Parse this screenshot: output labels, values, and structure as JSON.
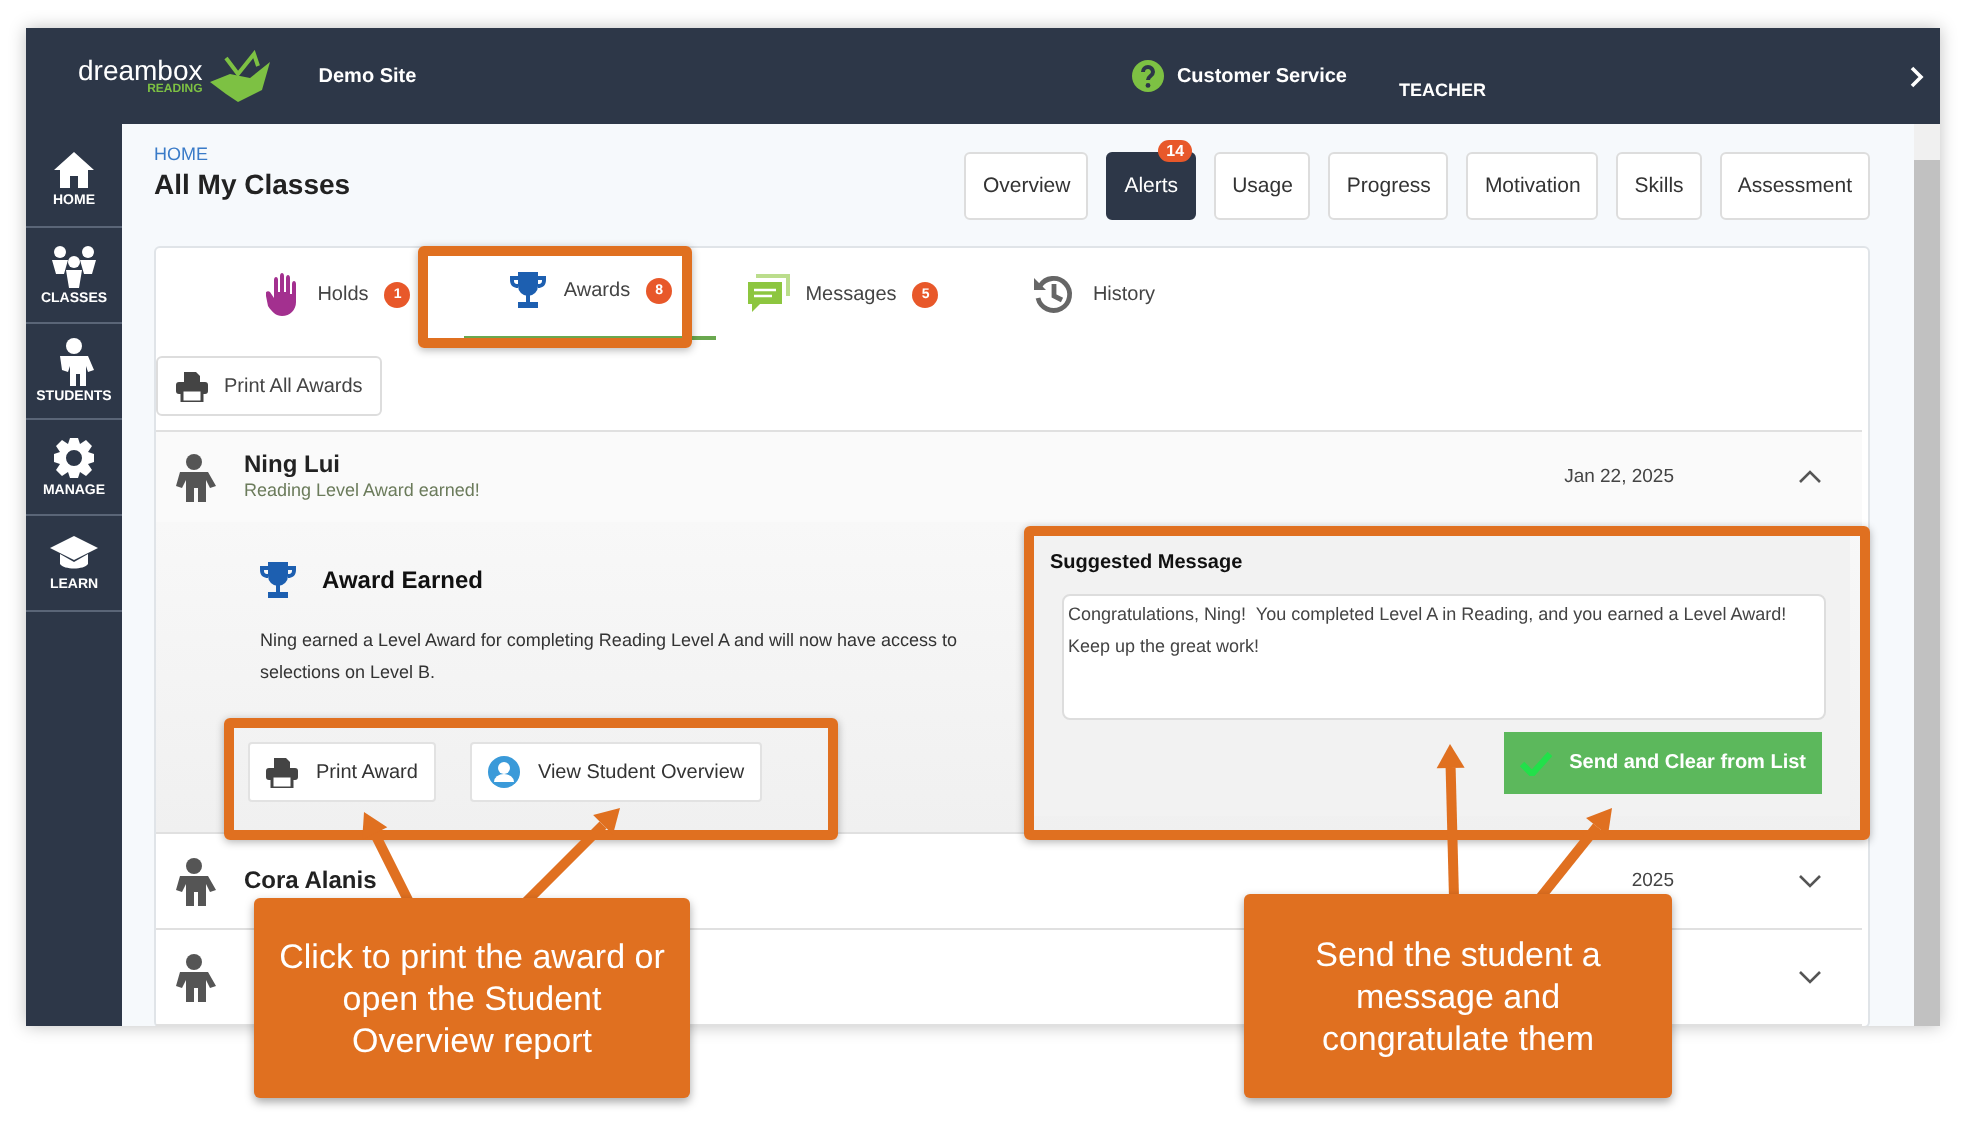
{
  "header": {
    "logo_word": "dreambox",
    "logo_sub": "READING",
    "site": "Demo Site",
    "help": "Customer Service",
    "role": "TEACHER"
  },
  "sidebar": {
    "items": [
      {
        "label": "HOME",
        "kind": "home"
      },
      {
        "label": "CLASSES",
        "kind": "classes"
      },
      {
        "label": "STUDENTS",
        "kind": "students"
      },
      {
        "label": "MANAGE",
        "kind": "manage"
      },
      {
        "label": "LEARN",
        "kind": "learn"
      }
    ]
  },
  "breadcrumb": "HOME",
  "title": "All My Classes",
  "views": [
    {
      "label": "Overview",
      "selected": false
    },
    {
      "label": "Alerts",
      "selected": true,
      "badge": "14"
    },
    {
      "label": "Usage",
      "selected": false
    },
    {
      "label": "Progress",
      "selected": false
    },
    {
      "label": "Motivation",
      "selected": false
    },
    {
      "label": "Skills",
      "selected": false
    },
    {
      "label": "Assessment",
      "selected": false
    }
  ],
  "alert_tabs": [
    {
      "label": "Holds",
      "kind": "hand",
      "badge": "1",
      "selected": false
    },
    {
      "label": "Awards",
      "kind": "trophy",
      "badge": "8",
      "selected": true
    },
    {
      "label": "Messages",
      "kind": "chat",
      "badge": "5",
      "selected": false
    },
    {
      "label": "History",
      "kind": "history",
      "selected": false
    }
  ],
  "print_all": "Print All Awards",
  "students": [
    {
      "name": "Ning Lui",
      "subtitle": "Reading Level Award earned!",
      "date": "Jan 22, 2025",
      "expanded": true
    },
    {
      "name": "Cora Alanis",
      "date": "2025",
      "expanded": false
    },
    {
      "expanded": false
    }
  ],
  "detail": {
    "heading": "Award Earned",
    "body": "Ning earned a Level Award for completing Reading Level A and will now have access to selections on Level B.",
    "buttons": [
      {
        "label": "Print Award",
        "kind": "print"
      },
      {
        "label": "View Student Overview",
        "kind": "student"
      }
    ],
    "suggested_heading": "Suggested Message",
    "message": "Congratulations, Ning!  You completed Level A in Reading, and you earned a Level Award! Keep up the great work!",
    "send": "Send and Clear from List"
  },
  "callouts": [
    "Click to print the award or open the Student Overview report",
    "Send the student a message and congratulate them"
  ]
}
